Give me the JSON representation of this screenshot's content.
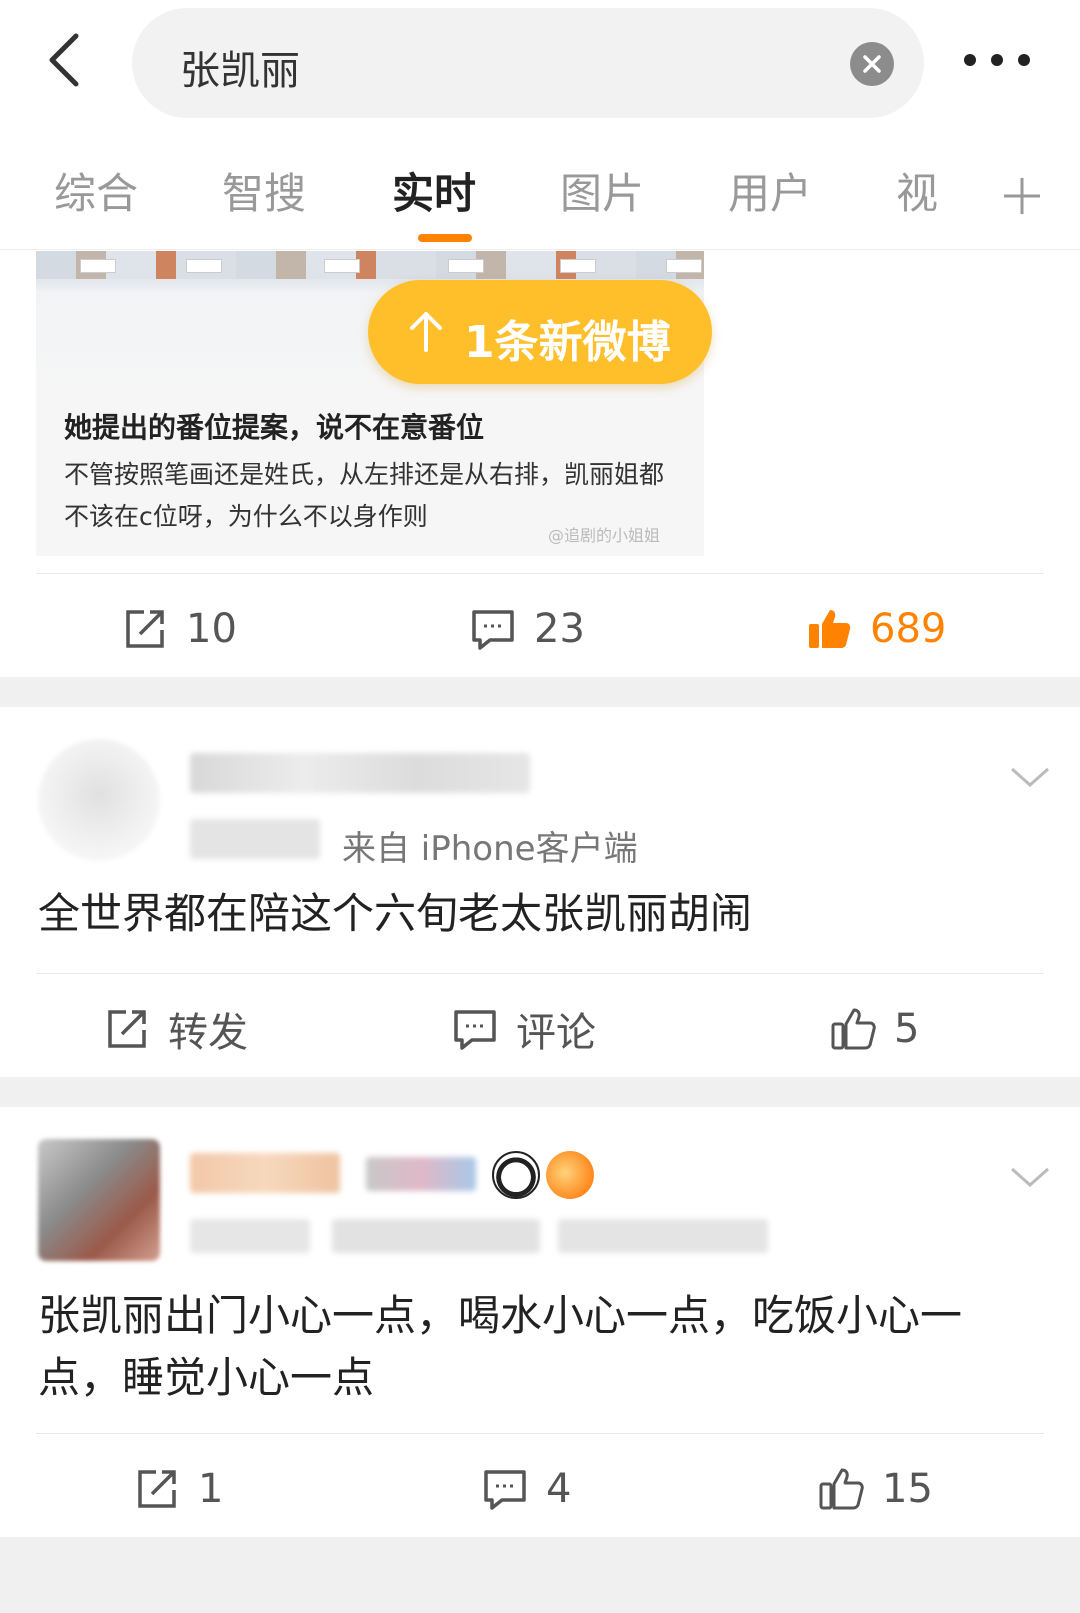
{
  "search": {
    "query": "张凯丽"
  },
  "tabs": [
    {
      "label": "综合"
    },
    {
      "label": "智搜"
    },
    {
      "label": "实时"
    },
    {
      "label": "图片"
    },
    {
      "label": "用户"
    },
    {
      "label": "视"
    }
  ],
  "new_posts_banner": "1条新微博",
  "card1": {
    "caption_title": "她提出的番位提案，说不在意番位",
    "caption_body": "不管按照笔画还是姓氏，从左排还是从右排，凯丽姐都不该在c位呀，为什么不以身作则",
    "watermark": "@追剧的小姐姐",
    "repost_count": "10",
    "comment_count": "23",
    "like_count": "689"
  },
  "post1": {
    "meta": "来自 iPhone客户端",
    "text": "全世界都在陪这个六旬老太张凯丽胡闹",
    "repost_label": "转发",
    "comment_label": "评论",
    "like_count": "5"
  },
  "post2": {
    "text": "张凯丽出门小心一点，喝水小心一点，吃饭小心一点，睡觉小心一点",
    "repost_count": "1",
    "comment_count": "4",
    "like_count": "15"
  },
  "colors": {
    "accent": "#ff8200",
    "banner": "#ffbf2b"
  }
}
